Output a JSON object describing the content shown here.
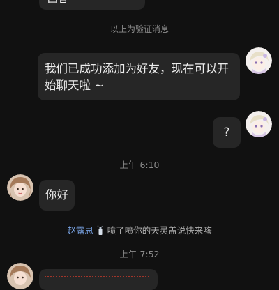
{
  "messages": {
    "top_partial": "回答",
    "verify_notice": "以上为验证消息",
    "friend_added": "我们已成功添加为好友，现在可以开始聊天啦 ~",
    "question": "?",
    "time_1": "上午 6:10",
    "hello": "你好",
    "poke_name": "赵露思",
    "poke_text": "喷了喷你的天灵盖说快来嗨",
    "time_2": "上午 7:52"
  },
  "colors": {
    "background": "#111111",
    "bubble": "#262626",
    "name_link": "#7aa5e6",
    "muted": "#8c8c8c",
    "red_partial": "#c0392b"
  },
  "icons": {
    "poke": "spray-bottle-icon"
  }
}
